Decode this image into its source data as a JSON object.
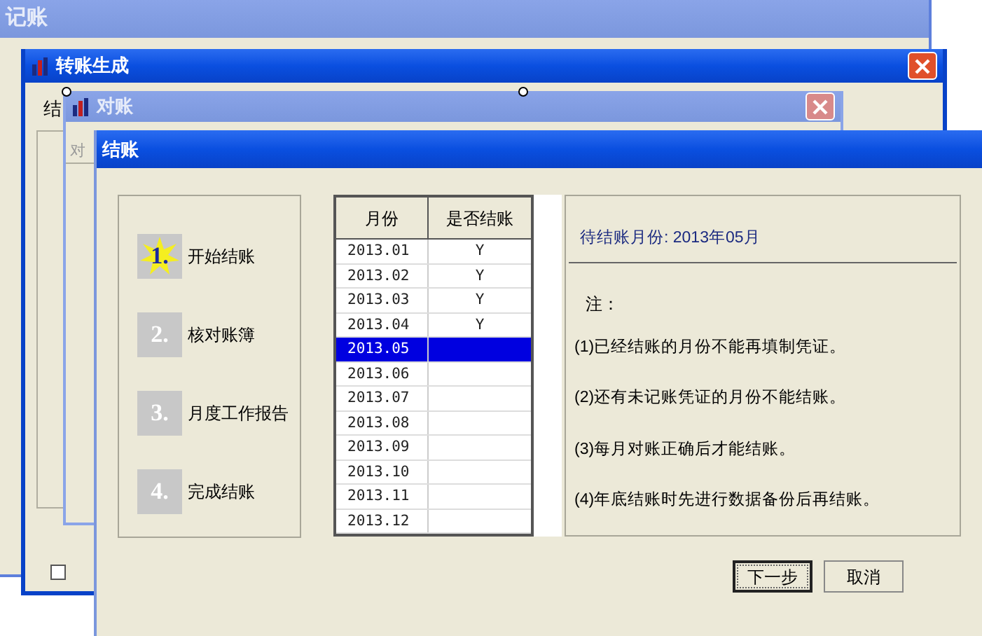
{
  "background_windows": [
    {
      "title": "记账",
      "active": false
    },
    {
      "title": "转账生成",
      "active": true,
      "label": "结",
      "checkbox_checked": false
    },
    {
      "title": "对账",
      "active": false,
      "toolbar_label": "对"
    }
  ],
  "dialog": {
    "title": "结账",
    "steps": [
      {
        "number": "1.",
        "label": "开始结账",
        "selected": true
      },
      {
        "number": "2.",
        "label": "核对账簿",
        "selected": false
      },
      {
        "number": "3.",
        "label": "月度工作报告",
        "selected": false
      },
      {
        "number": "4.",
        "label": "完成结账",
        "selected": false
      }
    ],
    "table": {
      "columns": [
        "月份",
        "是否结账"
      ],
      "rows": [
        {
          "month": "2013.01",
          "closed": "Y",
          "selected": false
        },
        {
          "month": "2013.02",
          "closed": "Y",
          "selected": false
        },
        {
          "month": "2013.03",
          "closed": "Y",
          "selected": false
        },
        {
          "month": "2013.04",
          "closed": "Y",
          "selected": false
        },
        {
          "month": "2013.05",
          "selected": true
        },
        {
          "month": "2013.06",
          "selected": false
        },
        {
          "month": "2013.07",
          "selected": false
        },
        {
          "month": "2013.08",
          "selected": false
        },
        {
          "month": "2013.09",
          "selected": false
        },
        {
          "month": "2013.10",
          "selected": false
        },
        {
          "month": "2013.11",
          "selected": false
        },
        {
          "month": "2013.12",
          "selected": false
        }
      ]
    },
    "pending_month": "待结账月份: 2013年05月",
    "notes_heading": "注：",
    "notes": [
      "(1)已经结账的月份不能再填制凭证。",
      "(2)还有未记账凭证的月份不能结账。",
      "(3)每月对账正确后才能结账。",
      "(4)年底结账时先进行数据备份后再结账。"
    ],
    "buttons": [
      "下一步",
      "取消"
    ]
  }
}
